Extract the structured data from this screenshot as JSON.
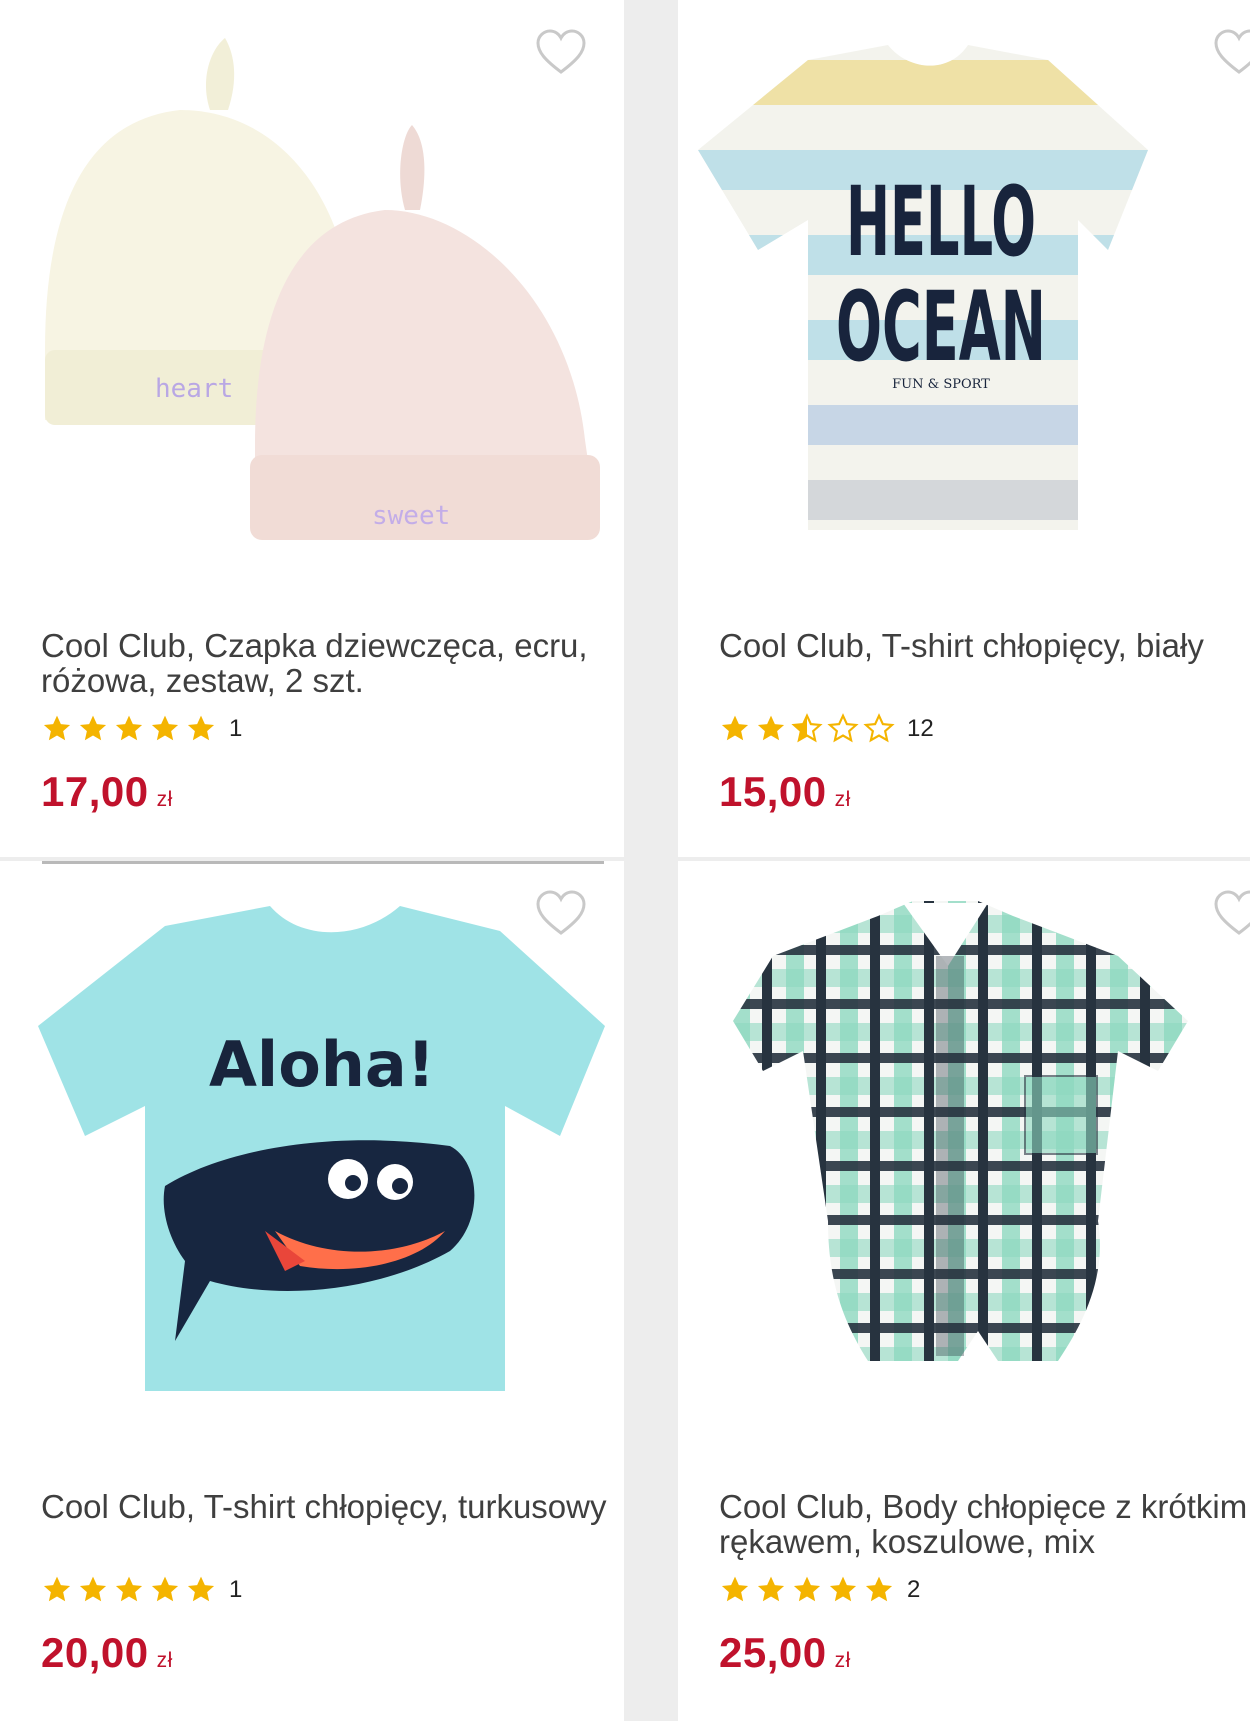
{
  "colors": {
    "price": "#c0122c",
    "star": "#f4b400",
    "background": "#ededed"
  },
  "products": [
    {
      "title": "Cool Club, Czapka dziewczęca, ecru, różowa, zestaw, 2 szt.",
      "rating": 5,
      "reviews": "1",
      "price": "17,00",
      "currency": "zł",
      "image": "knotted-baby-hats",
      "print_a": "heart",
      "print_b": "sweet"
    },
    {
      "title": "Cool Club, T-shirt chłopięcy, biały",
      "rating": 2.5,
      "reviews": "12",
      "price": "15,00",
      "currency": "zł",
      "image": "striped-tshirt",
      "print_line1": "HELLO",
      "print_line2": "OCEAN",
      "print_small": "FUN & SPORT"
    },
    {
      "title": "Cool Club, T-shirt chłopięcy, turkusowy",
      "rating": 5,
      "reviews": "1",
      "price": "20,00",
      "currency": "zł",
      "image": "shark-tshirt",
      "print_line1": "Aloha!"
    },
    {
      "title": "Cool Club, Body chłopięce z krótkim rękawem, koszulowe, mix",
      "rating": 5,
      "reviews": "2",
      "price": "25,00",
      "currency": "zł",
      "image": "plaid-bodysuit"
    }
  ]
}
